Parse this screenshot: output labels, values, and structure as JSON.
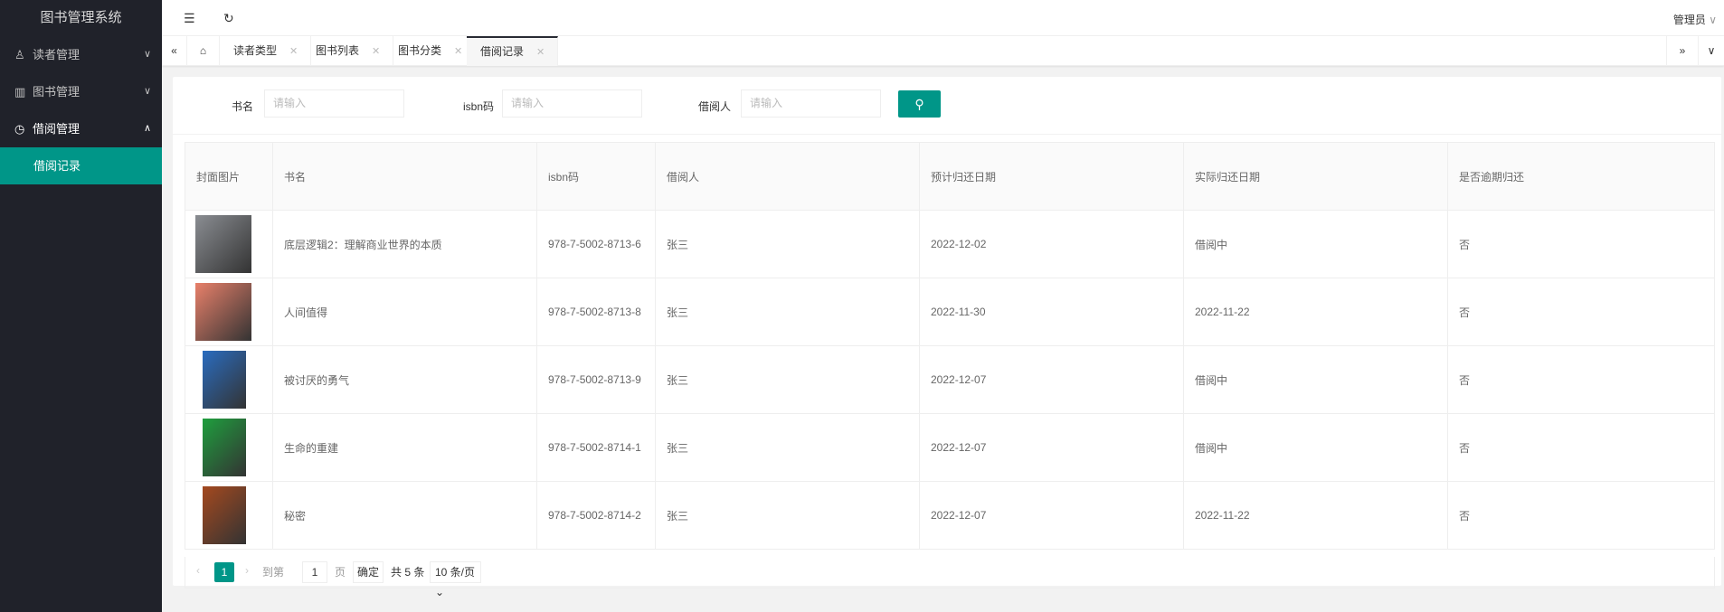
{
  "app": {
    "title": "图书管理系统"
  },
  "sidebar": {
    "items": [
      {
        "label": "读者管理",
        "icon": "user-icon",
        "expanded": false
      },
      {
        "label": "图书管理",
        "icon": "book-icon",
        "expanded": false
      },
      {
        "label": "借阅管理",
        "icon": "clock-icon",
        "expanded": true
      }
    ],
    "active_sub": "借阅记录"
  },
  "header": {
    "user": "管理员"
  },
  "tabs": [
    {
      "label": "读者类型"
    },
    {
      "label": "图书列表"
    },
    {
      "label": "图书分类"
    },
    {
      "label": "借阅记录",
      "active": true
    }
  ],
  "search": {
    "fields": [
      {
        "label": "书名",
        "placeholder": "请输入"
      },
      {
        "label": "isbn码",
        "placeholder": "请输入"
      },
      {
        "label": "借阅人",
        "placeholder": "请输入"
      }
    ]
  },
  "table": {
    "columns": [
      "封面图片",
      "书名",
      "isbn码",
      "借阅人",
      "预计归还日期",
      "实际归还日期",
      "是否逾期归还"
    ],
    "rows": [
      {
        "title": "底层逻辑2：理解商业世界的本质",
        "isbn": "978-7-5002-8713-6",
        "borrower": "张三",
        "due": "2022-12-02",
        "returned": "借阅中",
        "overdue": "否",
        "cover": "#8a8d92"
      },
      {
        "title": "人间值得",
        "isbn": "978-7-5002-8713-8",
        "borrower": "张三",
        "due": "2022-11-30",
        "returned": "2022-11-22",
        "overdue": "否",
        "cover": "#e8806a"
      },
      {
        "title": "被讨厌的勇气",
        "isbn": "978-7-5002-8713-9",
        "borrower": "张三",
        "due": "2022-12-07",
        "returned": "借阅中",
        "overdue": "否",
        "cover": "#2a6cbf"
      },
      {
        "title": "生命的重建",
        "isbn": "978-7-5002-8714-1",
        "borrower": "张三",
        "due": "2022-12-07",
        "returned": "借阅中",
        "overdue": "否",
        "cover": "#1f9e3e"
      },
      {
        "title": "秘密",
        "isbn": "978-7-5002-8714-2",
        "borrower": "张三",
        "due": "2022-12-07",
        "returned": "2022-11-22",
        "overdue": "否",
        "cover": "#a4491f"
      }
    ]
  },
  "pagination": {
    "current": "1",
    "goto_label": "到第",
    "goto_value": "1",
    "page_label": "页",
    "confirm": "确定",
    "total": "共 5 条",
    "page_size": "10 条/页"
  },
  "colors": {
    "accent": "#009688",
    "sidebar": "#20222a"
  }
}
